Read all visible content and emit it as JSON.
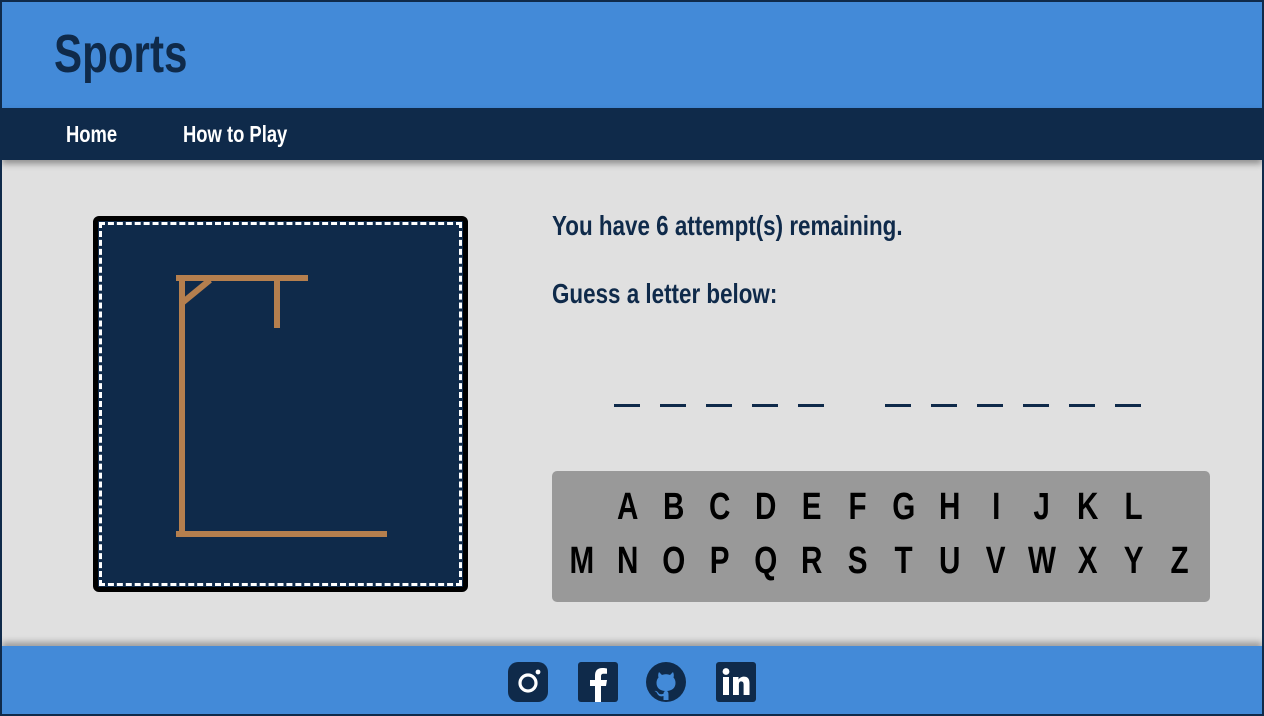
{
  "header": {
    "title": "Sports"
  },
  "nav": {
    "home": "Home",
    "how_to_play": "How to Play"
  },
  "game": {
    "attempts_text": "You have 6 attempt(s) remaining.",
    "prompt": "Guess a letter below:",
    "attempts_remaining": 6,
    "word_pattern": [
      5,
      6
    ],
    "keyboard_rows": [
      [
        "A",
        "B",
        "C",
        "D",
        "E",
        "F",
        "G",
        "H",
        "I",
        "J",
        "K",
        "L"
      ],
      [
        "M",
        "N",
        "O",
        "P",
        "Q",
        "R",
        "S",
        "T",
        "U",
        "V",
        "W",
        "X",
        "Y",
        "Z"
      ]
    ]
  },
  "footer": {
    "icons": [
      "instagram-icon",
      "facebook-icon",
      "github-icon",
      "linkedin-icon"
    ]
  },
  "colors": {
    "header_blue": "#438ad8",
    "navy": "#0f2a4a",
    "page_bg": "#e0e0e0",
    "gallows_wood": "#b57f4e",
    "keyboard_bg": "#999999"
  }
}
